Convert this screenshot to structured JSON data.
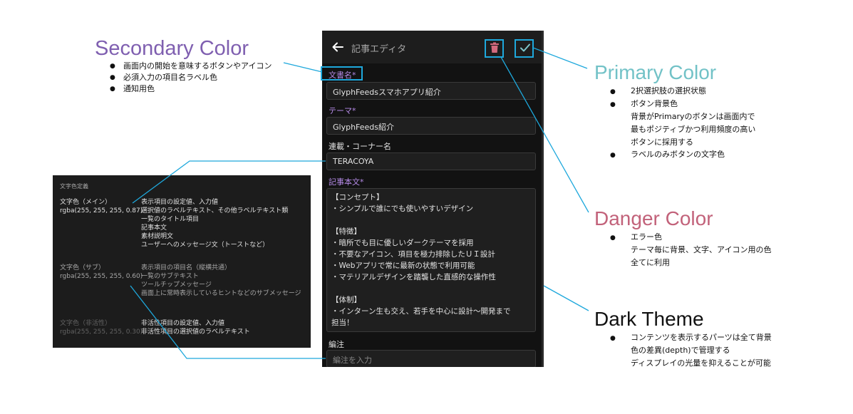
{
  "colors": {
    "secondary": "#7f5fb0",
    "primary": "#72c2c7",
    "danger": "#c2627a",
    "dark": "#111111",
    "accent_line": "#1ea8dc",
    "req_label": "#b48ae6",
    "delete_icon": "#d36a7e",
    "check_icon": "#7ec7cc"
  },
  "editor": {
    "title": "記事エディタ",
    "fields": [
      {
        "label": "文書名*",
        "value": "GlyphFeedsスマホアプリ紹介"
      },
      {
        "label": "テーマ*",
        "value": "GlyphFeeds紹介"
      },
      {
        "label": "連載・コーナー名",
        "value": "TERACOYA"
      }
    ],
    "body_label": "記事本文*",
    "body_lines": [
      "【コンセプト】",
      "・シンプルで誰にでも使いやすいデザイン",
      "",
      "【特徴】",
      "・暗所でも目に優しいダークテーマを採用",
      "・不要なアイコン、項目を極力排除したＵＩ設計",
      "・Webアプリで常に最新の状態で利用可能",
      "・マテリアルデザインを踏襲した直感的な操作性",
      "",
      "【体制】",
      "・インターン生も交え、若手を中心に設計～開発まで",
      "担当！"
    ],
    "note_label": "編注",
    "note_placeholder": "編注を入力"
  },
  "text_panel": {
    "heading": "文字色定義",
    "groups": [
      {
        "name": "文字色（メイン）",
        "rgba": "rgba(255, 255, 255, 0.87)",
        "items": [
          "表示項目の設定値、入力値",
          "選択値のラベルテキスト、その他ラベルテキスト類",
          "一覧のタイトル項目",
          "記事本文",
          "素材説明文",
          "ユーザーへのメッセージ文（トーストなど）"
        ]
      },
      {
        "name": "文字色（サブ）",
        "rgba": "rgba(255, 255, 255, 0.60)",
        "items": [
          "表示項目の項目名（縦横共通）",
          "一覧のサブテキスト",
          "ツールチップメッセージ",
          "画面上に常時表示しているヒントなどのサブメッセージ"
        ]
      },
      {
        "name": "文字色（非活性）",
        "rgba": "rgba(255, 255, 255, 0.30)",
        "items": [
          "非活性項目の設定値、入力値",
          "非活性項目の選択値のラベルテキスト"
        ]
      }
    ]
  },
  "annotations": {
    "secondary": {
      "title": "Secondary Color",
      "bullets": [
        "画面内の開始を意味するボタンやアイコン",
        "必須入力の項目名ラベル色",
        "通知用色"
      ]
    },
    "primary": {
      "title": "Primary Color",
      "bullets": [
        {
          "text": "2択選択肢の選択状態",
          "cont": []
        },
        {
          "text": "ボタン背景色",
          "cont": [
            "背景がPrimaryのボタンは画面内で",
            "最もポジティブかつ利用頻度の高い",
            "ボタンに採用する"
          ]
        },
        {
          "text": "ラベルのみボタンの文字色",
          "cont": []
        }
      ]
    },
    "danger": {
      "title": "Danger Color",
      "bullets": [
        "エラー色"
      ],
      "cont": [
        "テーマ毎に背景、文字、アイコン用の色",
        "全てに利用"
      ]
    },
    "dark": {
      "title": "Dark Theme",
      "bullets": [
        "コンテンツを表示するパーツは全て背景"
      ],
      "cont": [
        "色の差異(depth)で管理する",
        "ディスプレイの光量を抑えることが可能"
      ]
    }
  }
}
